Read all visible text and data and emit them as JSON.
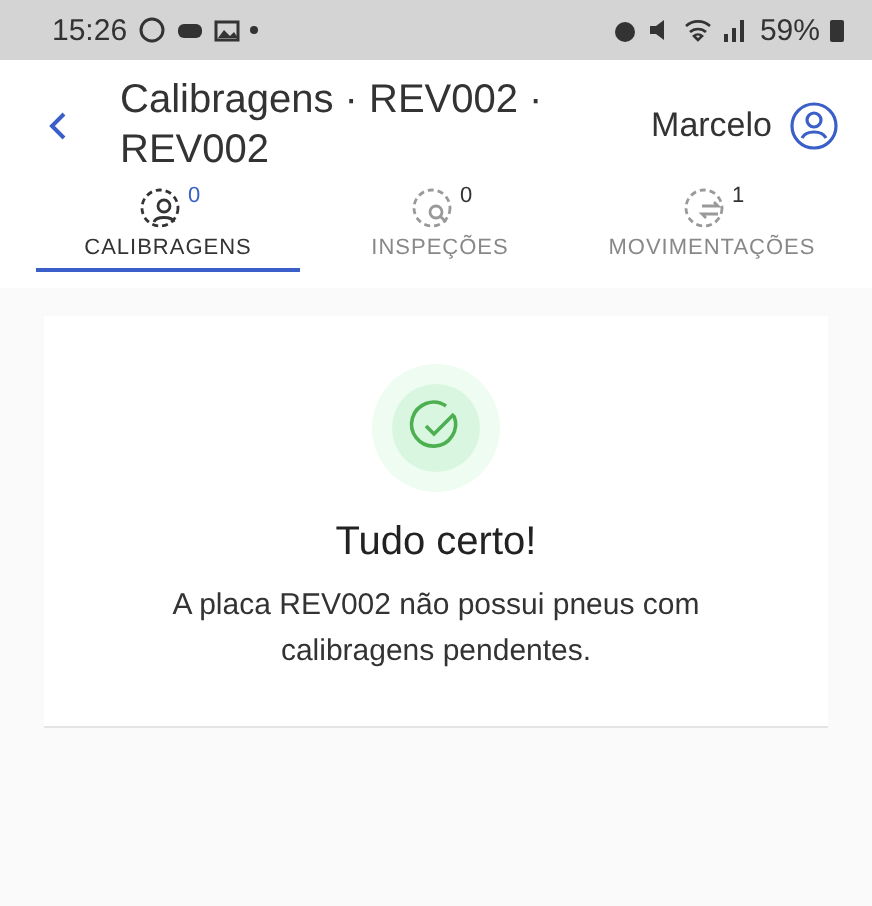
{
  "status_bar": {
    "time": "15:26",
    "battery": "59%"
  },
  "header": {
    "title": "Calibragens · REV002 · REV002",
    "user": "Marcelo"
  },
  "tabs": [
    {
      "kind": "calibration",
      "label": "CALIBRAGENS",
      "count": "0",
      "selected": true
    },
    {
      "kind": "inspection",
      "label": "INSPEÇÕES",
      "count": "0",
      "selected": false
    },
    {
      "kind": "movement",
      "label": "MOVIMENTAÇÕES",
      "count": "1",
      "selected": false
    }
  ],
  "empty_state": {
    "title": "Tudo certo!",
    "message": "A placa REV002 não possui pneus com calibragens pendentes."
  }
}
